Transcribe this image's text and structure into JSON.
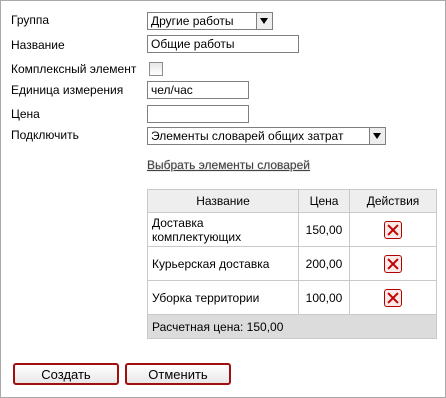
{
  "form": {
    "group": {
      "label": "Группа",
      "value": "Другие работы"
    },
    "name": {
      "label": "Название",
      "value": "Общие работы"
    },
    "complex": {
      "label": "Комплексный элемент",
      "checked": false
    },
    "unit": {
      "label": "Единица измерения",
      "value": "чел/час"
    },
    "price": {
      "label": "Цена",
      "value": ""
    },
    "connect": {
      "label": "Подключить",
      "value": "Элементы словарей общих затрат"
    }
  },
  "choose_link": "Выбрать элементы словарей",
  "table": {
    "headers": [
      "Название",
      "Цена",
      "Действия"
    ],
    "rows": [
      {
        "name": "Доставка комплектующих",
        "price": "150,00",
        "action_icon": "delete-icon"
      },
      {
        "name": "Курьерская доставка",
        "price": "200,00",
        "action_icon": "delete-icon"
      },
      {
        "name": "Уборка территории",
        "price": "100,00",
        "action_icon": "delete-icon"
      }
    ],
    "footer": "Расчетная цена: 150,00"
  },
  "buttons": {
    "create": "Создать",
    "cancel": "Отменить"
  },
  "colors": {
    "button_border": "#a01010",
    "delete_icon": "#c40000",
    "header_bg": "#eeeeee",
    "footer_bg": "#dcdcdc"
  }
}
